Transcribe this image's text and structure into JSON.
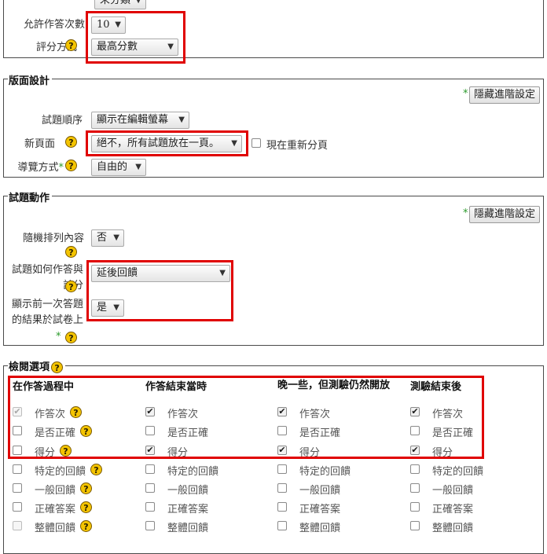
{
  "top": {
    "partial_select": "未分類",
    "attempts_label": "允許作答次數",
    "attempts_value": "10",
    "grading_label": "評分方式",
    "grading_value": "最高分數"
  },
  "layout_section": {
    "legend": "版面設計",
    "adv_button": "隱藏進階設定",
    "order_label": "試題順序",
    "order_value": "顯示在編輯螢幕",
    "newpage_label": "新頁面",
    "newpage_value": "絕不，所有試題放在一頁。",
    "repaginate_label": "現在重新分頁",
    "nav_label": "導覽方式",
    "nav_value": "自由的"
  },
  "behaviour_section": {
    "legend": "試題動作",
    "adv_button": "隱藏進階設定",
    "shuffle_label": "隨機排列內容",
    "shuffle_value": "否",
    "how_label": "試題如何作答與計分",
    "how_value": "延後回饋",
    "prev_label": "顯示前一次答題的結果於試卷上",
    "prev_value": "是"
  },
  "review_section": {
    "legend": "檢閱選項",
    "columns": [
      {
        "header": "在作答過程中",
        "items": [
          {
            "label": "作答次",
            "checked": true,
            "disabled": true,
            "help": true
          },
          {
            "label": "是否正確",
            "checked": false,
            "disabled": false,
            "help": true
          },
          {
            "label": "得分",
            "checked": false,
            "disabled": false,
            "help": true
          },
          {
            "label": "特定的回饋",
            "checked": false,
            "disabled": false,
            "help": true
          },
          {
            "label": "一般回饋",
            "checked": false,
            "disabled": false,
            "help": true
          },
          {
            "label": "正確答案",
            "checked": false,
            "disabled": false,
            "help": true
          },
          {
            "label": "整體回饋",
            "checked": false,
            "disabled": true,
            "help": true
          }
        ]
      },
      {
        "header": "作答結束當時",
        "items": [
          {
            "label": "作答次",
            "checked": true,
            "disabled": false,
            "help": false
          },
          {
            "label": "是否正確",
            "checked": false,
            "disabled": false,
            "help": false
          },
          {
            "label": "得分",
            "checked": true,
            "disabled": false,
            "help": false
          },
          {
            "label": "特定的回饋",
            "checked": false,
            "disabled": false,
            "help": false
          },
          {
            "label": "一般回饋",
            "checked": false,
            "disabled": false,
            "help": false
          },
          {
            "label": "正確答案",
            "checked": false,
            "disabled": false,
            "help": false
          },
          {
            "label": "整體回饋",
            "checked": false,
            "disabled": false,
            "help": false
          }
        ]
      },
      {
        "header": "晚一些，但測驗仍然開放",
        "items": [
          {
            "label": "作答次",
            "checked": true,
            "disabled": false,
            "help": false
          },
          {
            "label": "是否正確",
            "checked": false,
            "disabled": false,
            "help": false
          },
          {
            "label": "得分",
            "checked": true,
            "disabled": false,
            "help": false
          },
          {
            "label": "特定的回饋",
            "checked": false,
            "disabled": false,
            "help": false
          },
          {
            "label": "一般回饋",
            "checked": false,
            "disabled": false,
            "help": false
          },
          {
            "label": "正確答案",
            "checked": false,
            "disabled": false,
            "help": false
          },
          {
            "label": "整體回饋",
            "checked": false,
            "disabled": false,
            "help": false
          }
        ]
      },
      {
        "header": "測驗結束後",
        "items": [
          {
            "label": "作答次",
            "checked": true,
            "disabled": false,
            "help": false
          },
          {
            "label": "是否正確",
            "checked": false,
            "disabled": false,
            "help": false
          },
          {
            "label": "得分",
            "checked": true,
            "disabled": false,
            "help": false
          },
          {
            "label": "特定的回饋",
            "checked": false,
            "disabled": false,
            "help": false
          },
          {
            "label": "一般回饋",
            "checked": false,
            "disabled": false,
            "help": false
          },
          {
            "label": "正確答案",
            "checked": false,
            "disabled": false,
            "help": false
          },
          {
            "label": "整體回饋",
            "checked": false,
            "disabled": false,
            "help": false
          }
        ]
      }
    ]
  },
  "colors": {
    "highlight": "#e00000",
    "help_icon": "#f4c400",
    "required_star": "#2a9a2a"
  }
}
